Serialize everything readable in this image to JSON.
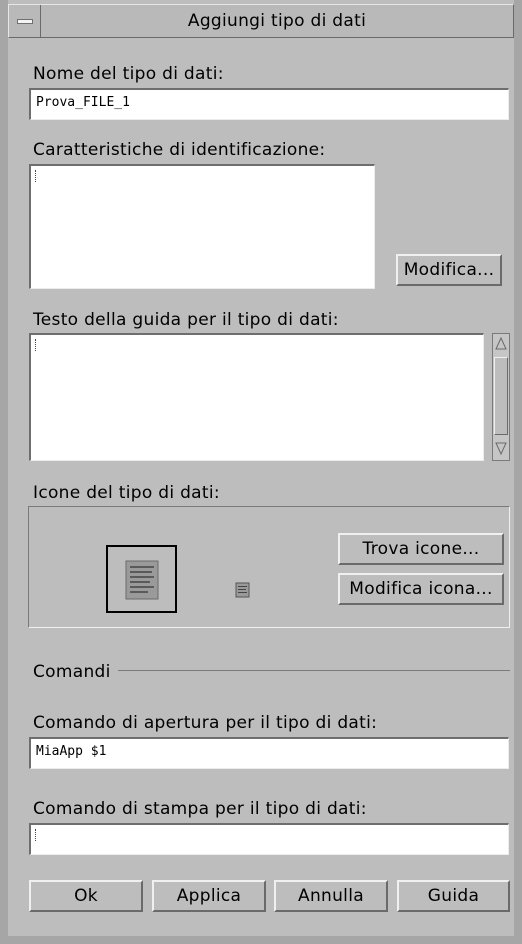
{
  "window": {
    "title": "Aggiungi tipo di dati"
  },
  "fields": {
    "name_label": "Nome del tipo di dati:",
    "name_value": "Prova_FILE_1",
    "ident_label": "Caratteristiche di identificazione:",
    "ident_value": "",
    "modify_button": "Modifica...",
    "help_label": "Testo della guida per il tipo di dati:",
    "help_value": ""
  },
  "icons": {
    "label": "Icone del tipo di dati:",
    "find_button": "Trova icone...",
    "edit_button": "Modifica icona..."
  },
  "commands": {
    "section_label": "Comandi",
    "open_label": "Comando di apertura per il tipo di dati:",
    "open_value": "MiaApp $1",
    "print_label": "Comando di stampa per il tipo di dati:",
    "print_value": ""
  },
  "buttons": {
    "ok": "Ok",
    "apply": "Applica",
    "cancel": "Annulla",
    "help": "Guida"
  }
}
